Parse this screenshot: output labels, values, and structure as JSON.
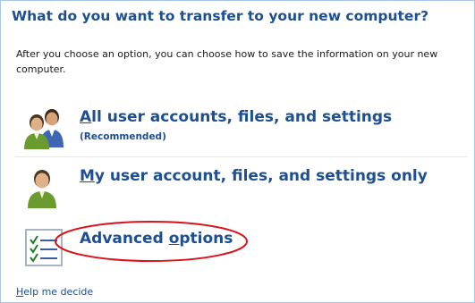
{
  "header": {
    "title": "What do you want to transfer to your new computer?"
  },
  "description": {
    "text": "After you choose an option, you can choose how to save the information on your new computer."
  },
  "options": [
    {
      "accel": "A",
      "label_rest": "ll user accounts, files, and settings",
      "sublabel": "(Recommended)",
      "icon": "two-users-icon"
    },
    {
      "accel": "M",
      "label_rest": "y user account, files, and settings only",
      "icon": "single-user-icon"
    },
    {
      "label_pre": "Advanced ",
      "accel": "o",
      "label_rest": "ptions",
      "icon": "checklist-icon"
    }
  ],
  "help": {
    "accel": "H",
    "rest": "elp me decide"
  },
  "colors": {
    "link": "#1d4f91",
    "annotation": "#d9141c"
  }
}
